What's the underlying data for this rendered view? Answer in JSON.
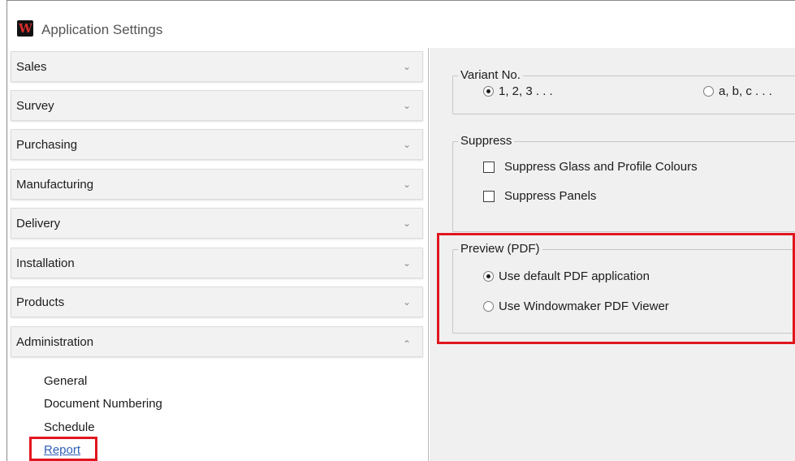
{
  "window": {
    "title": "Application Settings",
    "logo_letter": "W",
    "logo_icon": "windowmaker-logo-icon"
  },
  "sidebar": {
    "sections": [
      {
        "label": "Sales",
        "expanded": false
      },
      {
        "label": "Survey",
        "expanded": false
      },
      {
        "label": "Purchasing",
        "expanded": false
      },
      {
        "label": "Manufacturing",
        "expanded": false
      },
      {
        "label": "Delivery",
        "expanded": false
      },
      {
        "label": "Installation",
        "expanded": false
      },
      {
        "label": "Products",
        "expanded": false
      },
      {
        "label": "Administration",
        "expanded": true
      }
    ],
    "chevron_down": "⌄",
    "chevron_up": "⌃",
    "sub_items": [
      "General",
      "Document Numbering",
      "Schedule",
      "Report"
    ],
    "selected_sub_item": "Report",
    "highlight_color": "#e0161e"
  },
  "variant_no": {
    "legend": "Variant No.",
    "options": [
      {
        "label": "1, 2, 3 . . .",
        "checked": true
      },
      {
        "label": "a, b, c . . .",
        "checked": false
      }
    ]
  },
  "suppress": {
    "legend": "Suppress",
    "options": [
      {
        "label": "Suppress Glass and Profile Colours",
        "checked": false
      },
      {
        "label": "Suppress Panels",
        "checked": false
      }
    ]
  },
  "preview_pdf": {
    "legend": "Preview (PDF)",
    "options": [
      {
        "label": "Use default PDF application",
        "checked": true
      },
      {
        "label": "Use Windowmaker PDF Viewer",
        "checked": false
      }
    ]
  }
}
